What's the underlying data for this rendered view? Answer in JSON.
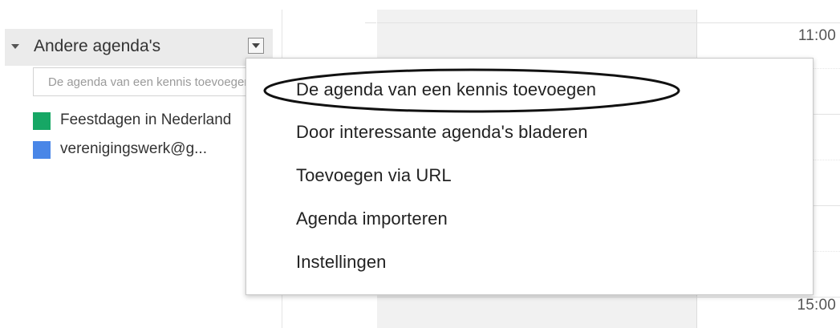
{
  "calendar": {
    "times": [
      "11:00",
      "15:00"
    ]
  },
  "sidebar": {
    "section_title": "Andere agenda's",
    "menu_button_icon": "dropdown-arrow-icon",
    "search": {
      "placeholder": "De agenda van een kennis toevoegen",
      "value": ""
    },
    "calendars": [
      {
        "label": "Feestdagen in Nederland",
        "color": "#16a765"
      },
      {
        "label": "verenigingswerk@g...",
        "color": "#4986e7"
      }
    ]
  },
  "menu": {
    "items": [
      {
        "label": "De agenda van een kennis toevoegen",
        "highlighted": true
      },
      {
        "label": "Door interessante agenda's bladeren"
      },
      {
        "label": "Toevoegen via URL"
      },
      {
        "label": "Agenda importeren"
      },
      {
        "label": "Instellingen"
      }
    ]
  }
}
